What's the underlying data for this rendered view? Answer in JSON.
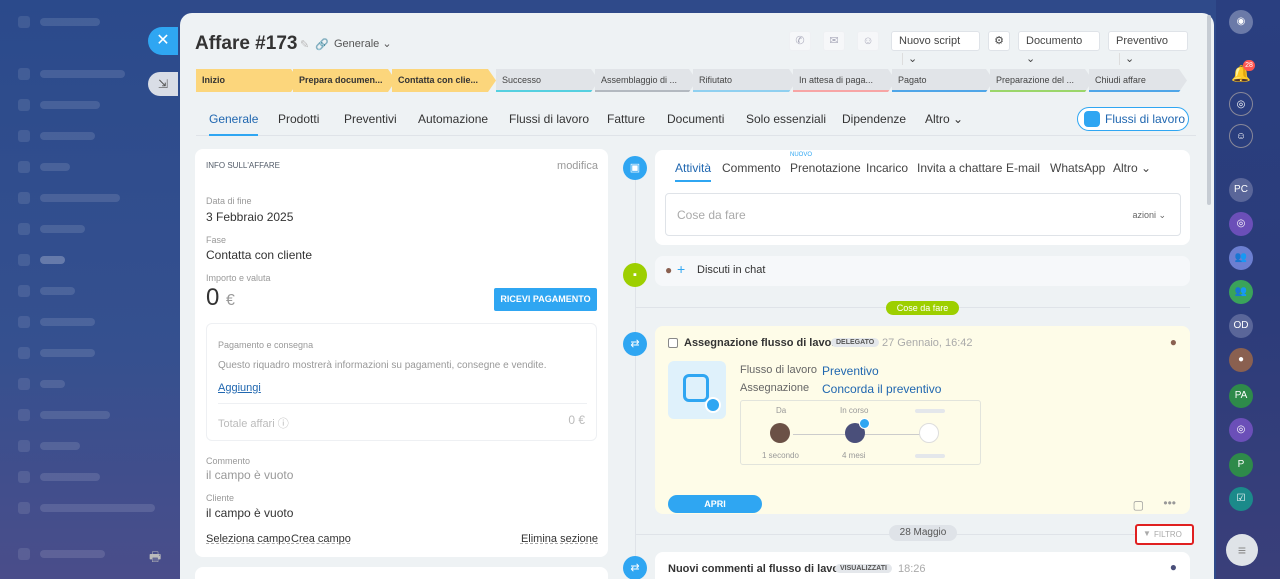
{
  "header": {
    "title": "Affare #173",
    "category": "Generale",
    "buttons": {
      "script": "Nuovo script",
      "documento": "Documento",
      "preventivo": "Preventivo"
    }
  },
  "stages": [
    {
      "label": "Inizio",
      "active": true,
      "color": "#fcd67c"
    },
    {
      "label": "Prepara documen...",
      "active": true,
      "color": "#fcd67c"
    },
    {
      "label": "Contatta con clie...",
      "active": true,
      "color": "#fcd67c"
    },
    {
      "label": "Successo",
      "active": false,
      "color": "#55d0e0"
    },
    {
      "label": "Assemblaggio di ...",
      "active": false,
      "color": "#b3b9c0"
    },
    {
      "label": "Rifiutato",
      "active": false,
      "color": "#8fd0f0"
    },
    {
      "label": "In attesa di paga...",
      "active": false,
      "color": "#f7a5a5"
    },
    {
      "label": "Pagato",
      "active": false,
      "color": "#4fa6e8"
    },
    {
      "label": "Preparazione del ...",
      "active": false,
      "color": "#9bd66a"
    },
    {
      "label": "Chiudi affare",
      "active": false,
      "color": "#4fa6e8"
    }
  ],
  "tabs": [
    "Generale",
    "Prodotti",
    "Preventivi",
    "Automazione",
    "Flussi di lavoro",
    "Fatture",
    "Documenti",
    "Solo essenziali",
    "Dipendenze",
    "Altro"
  ],
  "tabs_button": "Flussi di lavoro",
  "info": {
    "heading": "INFO SULL'AFFARE",
    "edit": "modifica",
    "date_label": "Data di fine",
    "date_value": "3 Febbraio 2025",
    "stage_label": "Fase",
    "stage_value": "Contatta con cliente",
    "amount_label": "Importo e valuta",
    "amount": "0",
    "currency": "€",
    "pay_button": "RICEVI PAGAMENTO",
    "payment_title": "Pagamento e consegna",
    "payment_text": "Questo riquadro mostrerà informazioni su pagamenti, consegne e vendite.",
    "payment_add": "Aggiungi",
    "total_label": "Totale affari",
    "total_value": "0 €",
    "comment_label": "Commento",
    "comment_value": "il campo è vuoto",
    "client_label": "Cliente",
    "client_value": "il campo è vuoto",
    "select_field": "Seleziona campo",
    "create_field": "Crea campo",
    "delete_section": "Elimina sezione"
  },
  "activity": {
    "tabs": [
      "Attività",
      "Commento",
      "Prenotazione",
      "Incarico",
      "Invita a chattare",
      "E-mail",
      "WhatsApp",
      "Altro"
    ],
    "new_badge": "NUOVO",
    "todo_placeholder": "Cose da fare",
    "actions": "azioni",
    "chat": "Discuti in chat",
    "todo_pill": "Cose da fare"
  },
  "task": {
    "title": "Assegnazione flusso di lavoro",
    "badge": "DELEGATO",
    "time": "27 Gennaio, 16:42",
    "flow_label": "Flusso di lavoro",
    "flow_value": "Preventivo",
    "assign_label": "Assegnazione",
    "assign_value": "Concorda il preventivo",
    "from_label": "Da",
    "progress_label": "In corso",
    "from_time": "1 secondo",
    "progress_time": "4 mesi",
    "open_button": "APRI"
  },
  "date_pill": "28 Maggio",
  "filter": "FILTRO",
  "comment_item": {
    "title": "Nuovi commenti al flusso di lavoro",
    "badge": "VISUALIZZATI",
    "time": "18:26"
  },
  "sidebar_right": {
    "notif_count": "28",
    "initials": [
      "PC",
      "OD",
      "PA",
      "P"
    ]
  },
  "colors": {
    "accent": "#2fa6f2",
    "stage_active": "#fcd67c",
    "highlight": "#e02020"
  }
}
